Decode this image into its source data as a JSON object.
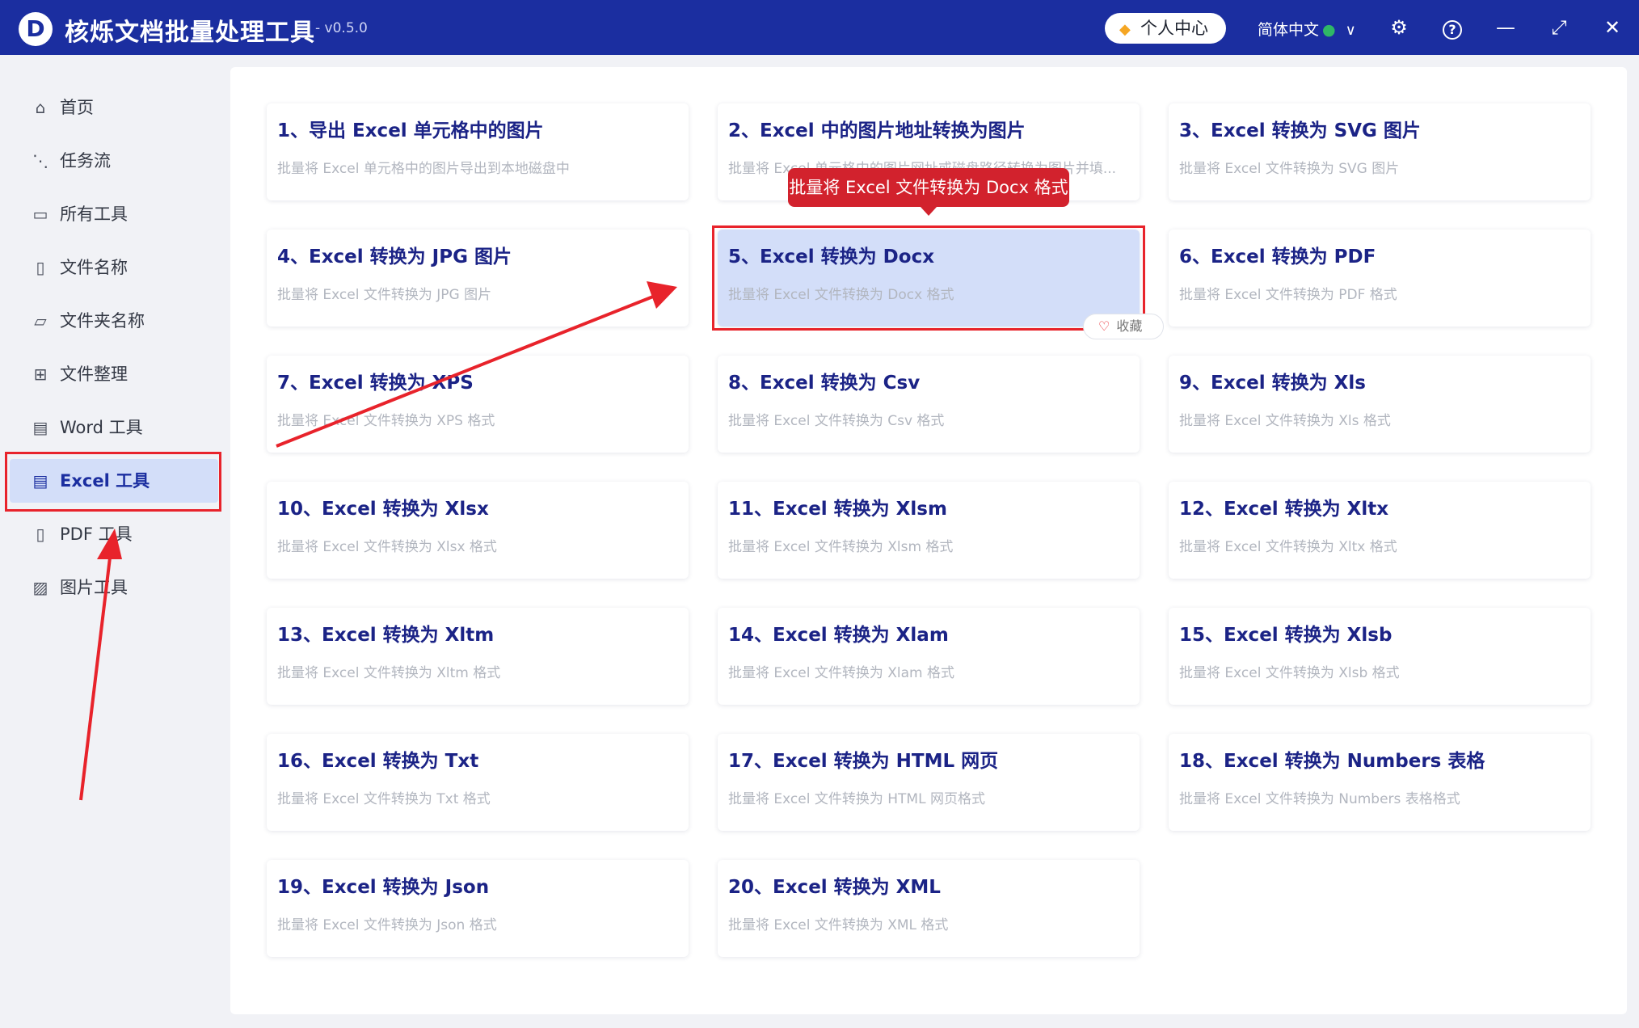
{
  "app": {
    "logo_letter": "D",
    "title": "核烁文档批量处理工具",
    "version": "- v0.5.0",
    "user_center": "个人中心",
    "language": "简体中文",
    "icons": [
      "settings-gear-icon",
      "help-icon",
      "minimize-icon",
      "maximize-icon",
      "close-icon"
    ]
  },
  "sidebar": {
    "items": [
      {
        "label": "首页",
        "icon": "home-icon"
      },
      {
        "label": "任务流",
        "icon": "workflow-icon"
      },
      {
        "label": "所有工具",
        "icon": "monitor-icon"
      },
      {
        "label": "文件名称",
        "icon": "file-name-icon"
      },
      {
        "label": "文件夹名称",
        "icon": "folder-icon"
      },
      {
        "label": "文件整理",
        "icon": "organize-icon"
      },
      {
        "label": "Word 工具",
        "icon": "word-icon"
      },
      {
        "label": "Excel 工具",
        "icon": "excel-icon"
      },
      {
        "label": "PDF 工具",
        "icon": "pdf-icon"
      },
      {
        "label": "图片工具",
        "icon": "image-icon"
      }
    ],
    "active": "Excel 工具"
  },
  "tools": [
    {
      "title": "1、导出 Excel 单元格中的图片",
      "desc": "批量将 Excel 单元格中的图片导出到本地磁盘中"
    },
    {
      "title": "2、Excel 中的图片地址转换为图片",
      "desc": "批量将 Excel 单元格中的图片网址或磁盘路径转换为图片并填..."
    },
    {
      "title": "3、Excel 转换为 SVG 图片",
      "desc": "批量将 Excel 文件转换为 SVG 图片"
    },
    {
      "title": "4、Excel 转换为 JPG 图片",
      "desc": "批量将 Excel 文件转换为 JPG 图片"
    },
    {
      "title": "5、Excel 转换为 Docx",
      "desc": "批量将 Excel 文件转换为 Docx 格式"
    },
    {
      "title": "6、Excel 转换为 PDF",
      "desc": "批量将 Excel 文件转换为 PDF 格式"
    },
    {
      "title": "7、Excel 转换为 XPS",
      "desc": "批量将 Excel 文件转换为 XPS 格式"
    },
    {
      "title": "8、Excel 转换为 Csv",
      "desc": "批量将 Excel 文件转换为 Csv 格式"
    },
    {
      "title": "9、Excel 转换为 Xls",
      "desc": "批量将 Excel 文件转换为 Xls 格式"
    },
    {
      "title": "10、Excel 转换为 Xlsx",
      "desc": "批量将 Excel 文件转换为 Xlsx 格式"
    },
    {
      "title": "11、Excel 转换为 Xlsm",
      "desc": "批量将 Excel 文件转换为 Xlsm 格式"
    },
    {
      "title": "12、Excel 转换为 Xltx",
      "desc": "批量将 Excel 文件转换为 Xltx 格式"
    },
    {
      "title": "13、Excel 转换为 Xltm",
      "desc": "批量将 Excel 文件转换为 Xltm 格式"
    },
    {
      "title": "14、Excel 转换为 Xlam",
      "desc": "批量将 Excel 文件转换为 Xlam 格式"
    },
    {
      "title": "15、Excel 转换为 Xlsb",
      "desc": "批量将 Excel 文件转换为 Xlsb 格式"
    },
    {
      "title": "16、Excel 转换为 Txt",
      "desc": "批量将 Excel 文件转换为 Txt 格式"
    },
    {
      "title": "17、Excel 转换为 HTML 网页",
      "desc": "批量将 Excel 文件转换为 HTML 网页格式"
    },
    {
      "title": "18、Excel 转换为 Numbers 表格",
      "desc": "批量将 Excel 文件转换为 Numbers 表格格式"
    },
    {
      "title": "19、Excel 转换为 Json",
      "desc": "批量将 Excel 文件转换为 Json 格式"
    },
    {
      "title": "20、Excel 转换为 XML",
      "desc": "批量将 Excel 文件转换为 XML 格式"
    }
  ],
  "selected_tool_index": 4,
  "tooltip": "批量将 Excel 文件转换为 Docx 格式",
  "favorite_label": "收藏",
  "colors": {
    "brand": "#1b2ea0",
    "highlight": "#e8232b",
    "selected_bg": "#d3def9"
  }
}
